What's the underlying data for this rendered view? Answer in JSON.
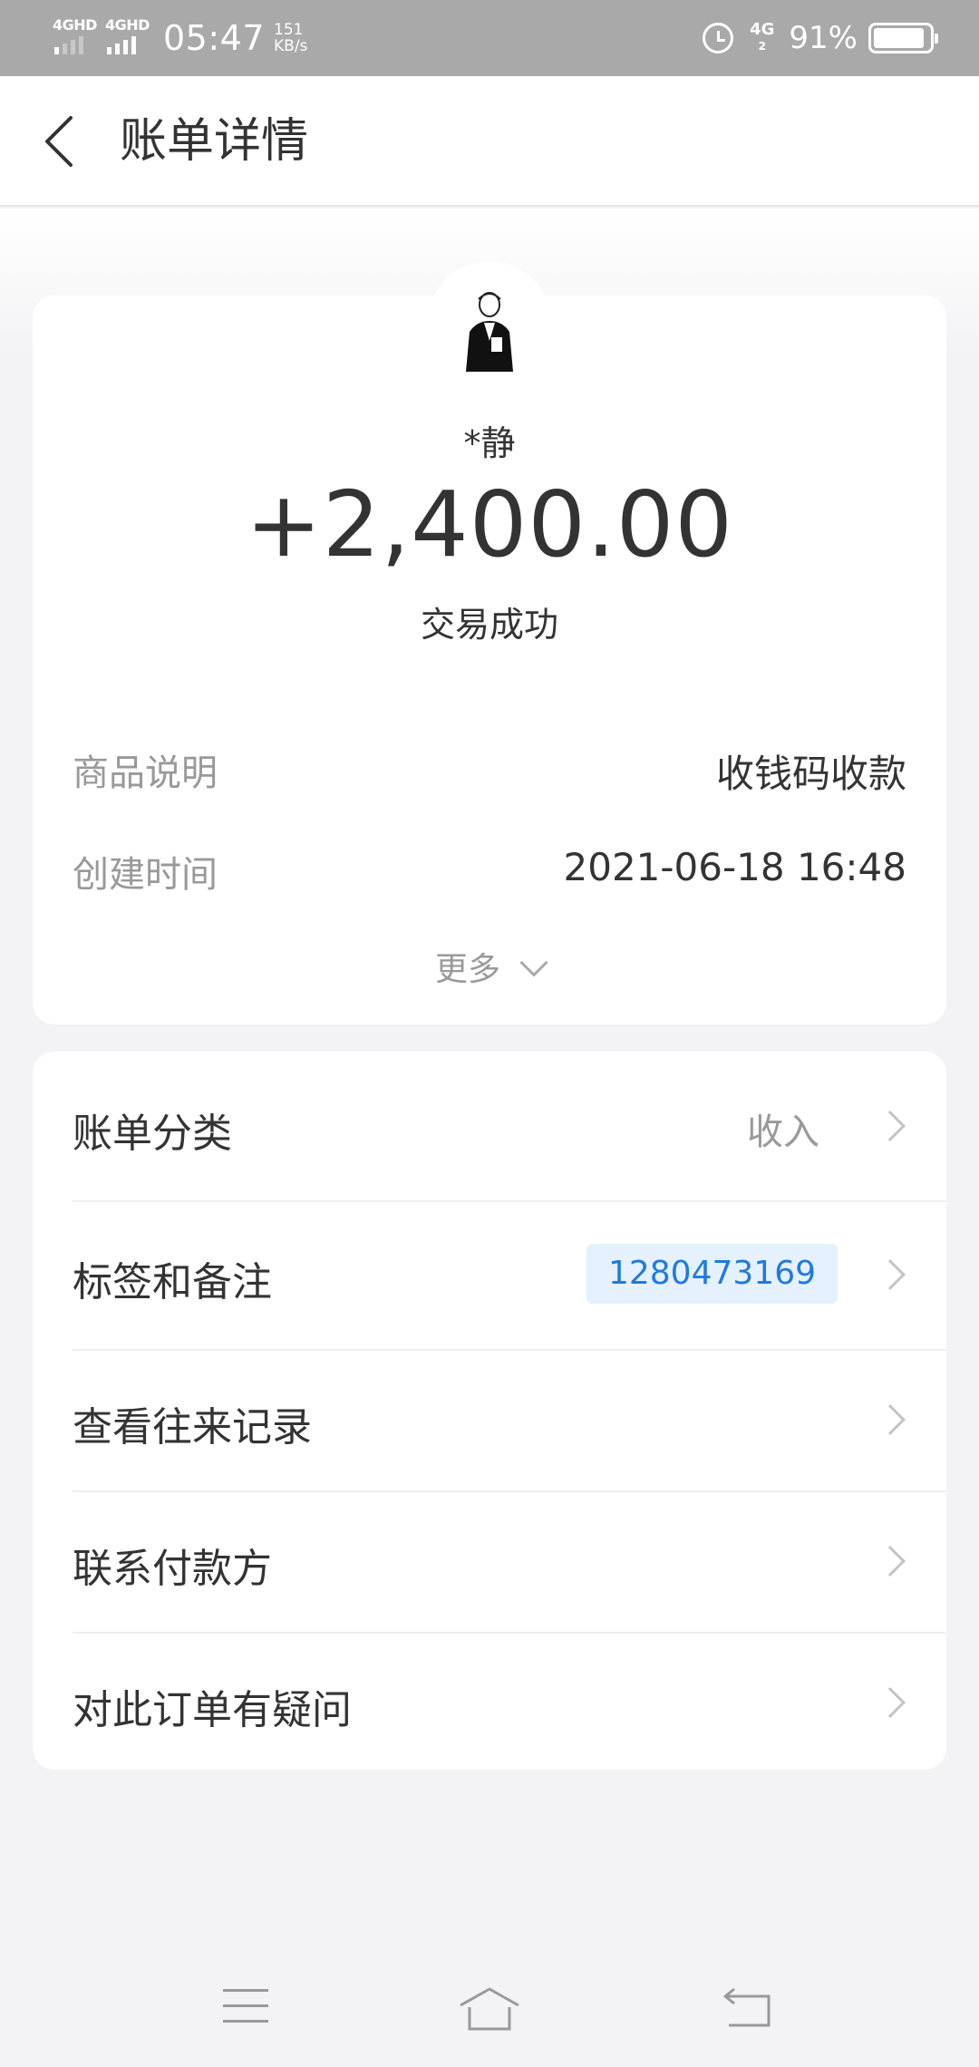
{
  "status_bar": {
    "sim1": "4GHD",
    "sim2": "4GHD",
    "time": "05:47",
    "speed_value": "151",
    "speed_unit": "KB/s",
    "network": "4G",
    "network_sub": "2",
    "battery": "91%",
    "battery_level": 0.91
  },
  "header": {
    "title": "账单详情"
  },
  "summary": {
    "payer_name": "*静",
    "amount": "+2,400.00",
    "status": "交易成功",
    "details": [
      {
        "label": "商品说明",
        "value": "收钱码收款"
      },
      {
        "label": "创建时间",
        "value": "2021-06-18 16:48"
      }
    ],
    "more_label": "更多"
  },
  "actions": {
    "bill_category": {
      "label": "账单分类",
      "value": "收入"
    },
    "tags_notes": {
      "label": "标签和备注",
      "tag": "1280473169"
    },
    "history": {
      "label": "查看往来记录"
    },
    "contact": {
      "label": "联系付款方"
    },
    "question": {
      "label": "对此订单有疑问"
    }
  },
  "colors": {
    "background": "#f3f3f5",
    "card": "#ffffff",
    "tag_bg": "#e6f1ff",
    "tag_text": "#1f7ae0",
    "muted": "#999999",
    "text": "#333333"
  }
}
